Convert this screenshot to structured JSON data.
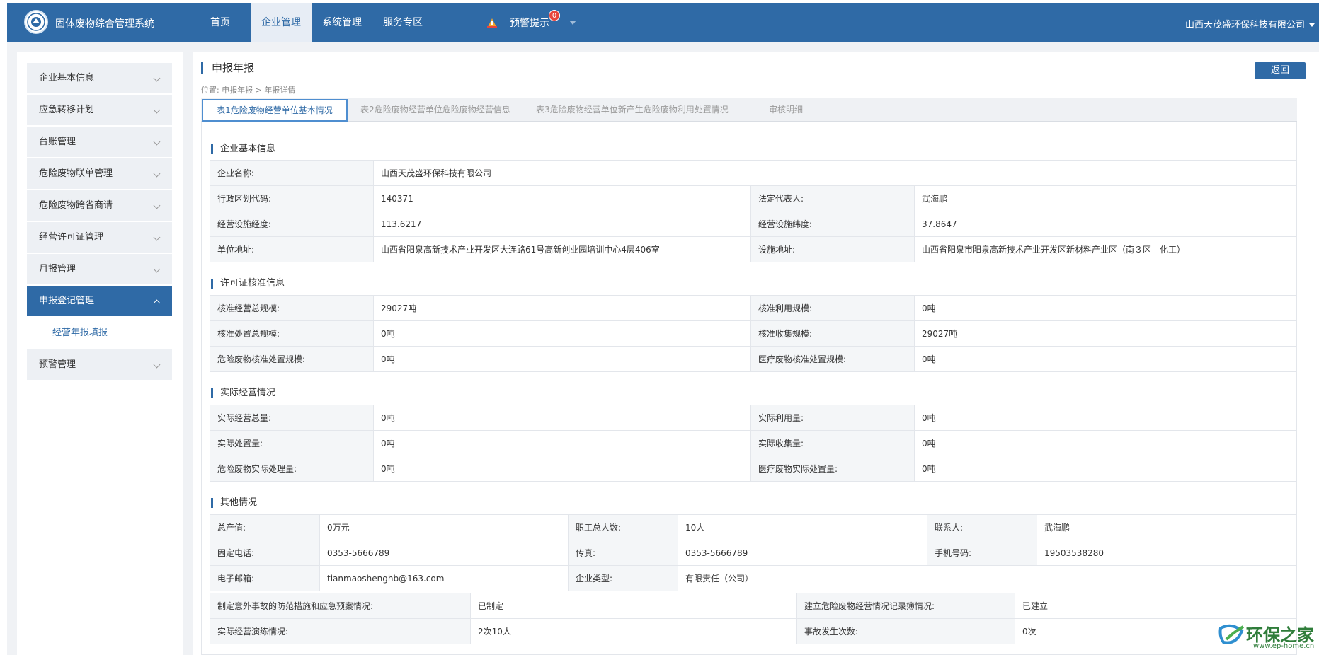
{
  "header": {
    "app_title": "固体废物综合管理系统",
    "nav": [
      "首页",
      "企业管理",
      "系统管理",
      "服务专区"
    ],
    "active_nav": "企业管理",
    "alert_label": "预警提示",
    "alert_count": "0",
    "company": "山西天茂盛环保科技有限公司"
  },
  "sidebar": {
    "items": [
      {
        "label": "企业基本信息"
      },
      {
        "label": "应急转移计划"
      },
      {
        "label": "台账管理"
      },
      {
        "label": "危险废物联单管理"
      },
      {
        "label": "危险废物跨省商请"
      },
      {
        "label": "经营许可证管理"
      },
      {
        "label": "月报管理"
      },
      {
        "label": "申报登记管理"
      },
      {
        "label": "预警管理"
      }
    ],
    "active_item": "申报登记管理",
    "sub_item": "经营年报填报"
  },
  "main": {
    "title": "申报年报",
    "back_label": "返回",
    "breadcrumb": "位置: 申报年报 > 年报详情",
    "tabs": [
      "表1危险废物经营单位基本情况",
      "表2危险废物经营单位危险废物经营信息",
      "表3危险废物经营单位新产生危险废物利用处置情况",
      "审核明细"
    ]
  },
  "sections": {
    "basic": {
      "title": "企业基本信息",
      "company_name_label": "企业名称:",
      "company_name": "山西天茂盛环保科技有限公司",
      "region_code_label": "行政区划代码:",
      "region_code": "140371",
      "legal_rep_label": "法定代表人:",
      "legal_rep": "武海鹏",
      "lng_label": "经营设施经度:",
      "lng": "113.6217",
      "lat_label": "经营设施纬度:",
      "lat": "37.8647",
      "address_label": "单位地址:",
      "address": "山西省阳泉高新技术产业开发区大连路61号高新创业园培训中心4层406室",
      "facility_address_label": "设施地址:",
      "facility_address": "山西省阳泉市阳泉高新技术产业开发区新材料产业区（南３区 - 化工）"
    },
    "license": {
      "title": "许可证核准信息",
      "rows": [
        [
          "核准经营总规模:",
          "29027吨",
          "核准利用规模:",
          "0吨"
        ],
        [
          "核准处置总规模:",
          "0吨",
          "核准收集规模:",
          "29027吨"
        ],
        [
          "危险废物核准处置规模:",
          "0吨",
          "医疗废物核准处置规模:",
          "0吨"
        ]
      ]
    },
    "actual": {
      "title": "实际经营情况",
      "rows": [
        [
          "实际经营总量:",
          "0吨",
          "实际利用量:",
          "0吨"
        ],
        [
          "实际处置量:",
          "0吨",
          "实际收集量:",
          "0吨"
        ],
        [
          "危险废物实际处理量:",
          "0吨",
          "医疗废物实际处置量:",
          "0吨"
        ]
      ]
    },
    "other": {
      "title": "其他情况",
      "rows": [
        [
          "总产值:",
          "0万元",
          "职工总人数:",
          "10人",
          "联系人:",
          "武海鹏"
        ],
        [
          "固定电话:",
          "0353-5666789",
          "传真:",
          "0353-5666789",
          "手机号码:",
          "19503538280"
        ],
        [
          "电子邮箱:",
          "tianmaoshenghb@163.com",
          "企业类型:",
          "有限责任（公司）"
        ]
      ],
      "rows2": [
        [
          "制定意外事故的防范措施和应急预案情况:",
          "已制定",
          "建立危险废物经营情况记录簿情况:",
          "已建立"
        ],
        [
          "实际经营演练情况:",
          "2次10人",
          "事故发生次数:",
          "0次"
        ]
      ]
    }
  },
  "watermark": {
    "text": "环保之家",
    "url": "www.ep-home.cn"
  }
}
